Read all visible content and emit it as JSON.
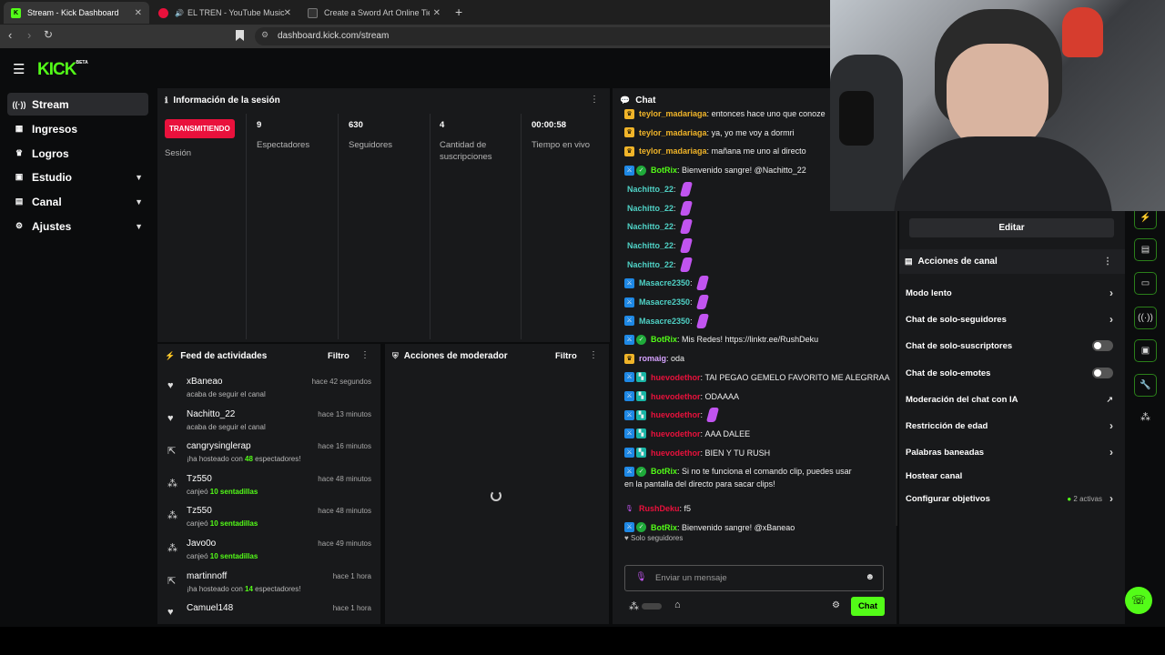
{
  "browser": {
    "tabs": [
      {
        "title": "Stream - Kick Dashboard"
      },
      {
        "title": "EL TREN - YouTube Music"
      },
      {
        "title": "Create a Sword Art Online Tier Li"
      }
    ],
    "url": "dashboard.kick.com/stream"
  },
  "brand": {
    "logo": "KICK",
    "beta": "BETA",
    "accent": "#53fc18"
  },
  "sidebar": {
    "items": [
      {
        "label": "Stream",
        "icon": "broadcast-icon"
      },
      {
        "label": "Ingresos",
        "icon": "revenue-icon"
      },
      {
        "label": "Logros",
        "icon": "trophy-icon"
      },
      {
        "label": "Estudio",
        "icon": "studio-icon"
      },
      {
        "label": "Canal",
        "icon": "channel-icon"
      },
      {
        "label": "Ajustes",
        "icon": "gear-icon"
      }
    ]
  },
  "session": {
    "title": "Información de la sesión",
    "badge": "TRANSMITIENDO",
    "badge_label": "Sesión",
    "stats": [
      {
        "value": "9",
        "label": "Espectadores"
      },
      {
        "value": "630",
        "label": "Seguidores"
      },
      {
        "value": "4",
        "label": "Cantidad de suscripciones"
      },
      {
        "value": "00:00:58",
        "label": "Tiempo en vivo"
      }
    ]
  },
  "feed": {
    "title": "Feed de actividades",
    "filter": "Filtro",
    "items": [
      {
        "name": "xBaneao",
        "time": "hace 42 segundos",
        "pre": "acaba de seguir el canal",
        "hl": "",
        "post": "",
        "icon": "heart-icon"
      },
      {
        "name": "Nachitto_22",
        "time": "hace 13 minutos",
        "pre": "acaba de seguir el canal",
        "hl": "",
        "post": "",
        "icon": "heart-icon"
      },
      {
        "name": "cangrysinglerap",
        "time": "hace 16 minutos",
        "pre": "¡ha hosteado con ",
        "hl": "48",
        "post": " espectadores!",
        "icon": "host-icon"
      },
      {
        "name": "Tz550",
        "time": "hace 48 minutos",
        "pre": "canjeó ",
        "hl": "10 sentadillas",
        "post": "",
        "icon": "points-icon"
      },
      {
        "name": "Tz550",
        "time": "hace 48 minutos",
        "pre": "canjeó ",
        "hl": "10 sentadillas",
        "post": "",
        "icon": "points-icon"
      },
      {
        "name": "Javo0o",
        "time": "hace 49 minutos",
        "pre": "canjeó ",
        "hl": "10 sentadillas",
        "post": "",
        "icon": "points-icon"
      },
      {
        "name": "martinnoff",
        "time": "hace 1 hora",
        "pre": "¡ha hosteado con ",
        "hl": "14",
        "post": " espectadores!",
        "icon": "host-icon"
      },
      {
        "name": "Camuel148",
        "time": "hace 1 hora",
        "pre": "",
        "hl": "",
        "post": "",
        "icon": "heart-icon"
      }
    ]
  },
  "moderator": {
    "title": "Acciones de moderador",
    "filter": "Filtro"
  },
  "chat": {
    "title": "Chat",
    "messages": [
      {
        "user": "teylor_madariaga",
        "color": "#f0b429",
        "text": "entonces hace uno que conoze",
        "badges": [
          "crown"
        ],
        "emote": false
      },
      {
        "user": "teylor_madariaga",
        "color": "#f0b429",
        "text": "ya, yo me voy a dormri",
        "badges": [
          "crown"
        ],
        "emote": false
      },
      {
        "user": "teylor_madariaga",
        "color": "#f0b429",
        "text": "mañana me uno al directo",
        "badges": [
          "crown"
        ],
        "emote": false
      },
      {
        "user": "BotRix",
        "color": "#53fc18",
        "text": "Bienvenido sangre! @Nachitto_22",
        "badges": [
          "mod",
          "verified"
        ],
        "emote": false
      },
      {
        "user": "Nachitto_22",
        "color": "#4fd1c5",
        "text": "",
        "badges": [],
        "emote": true
      },
      {
        "user": "Nachitto_22",
        "color": "#4fd1c5",
        "text": "",
        "badges": [],
        "emote": true
      },
      {
        "user": "Nachitto_22",
        "color": "#4fd1c5",
        "text": "",
        "badges": [],
        "emote": true
      },
      {
        "user": "Nachitto_22",
        "color": "#4fd1c5",
        "text": "",
        "badges": [],
        "emote": true
      },
      {
        "user": "Nachitto_22",
        "color": "#4fd1c5",
        "text": "",
        "badges": [],
        "emote": true
      },
      {
        "user": "Masacre2350",
        "color": "#4fd1c5",
        "text": "",
        "badges": [
          "mod"
        ],
        "emote": true
      },
      {
        "user": "Masacre2350",
        "color": "#4fd1c5",
        "text": "",
        "badges": [
          "mod"
        ],
        "emote": true
      },
      {
        "user": "Masacre2350",
        "color": "#4fd1c5",
        "text": "",
        "badges": [
          "mod"
        ],
        "emote": true
      },
      {
        "user": "BotRix",
        "color": "#53fc18",
        "text": "Mis Redes! https://linktr.ee/RushDeku",
        "badges": [
          "mod",
          "verified"
        ],
        "emote": false
      },
      {
        "user": "romaig",
        "color": "#d6a2ff",
        "text": "oda",
        "badges": [
          "crown"
        ],
        "emote": false
      },
      {
        "user": "huevodethor",
        "color": "#e9113c",
        "text": "TAI PEGAO GEMELO FAVORITO ME ALEGRRAA",
        "badges": [
          "mod",
          "sub"
        ],
        "emote": false
      },
      {
        "user": "huevodethor",
        "color": "#e9113c",
        "text": "ODAAAA",
        "badges": [
          "mod",
          "sub"
        ],
        "emote": false
      },
      {
        "user": "huevodethor",
        "color": "#e9113c",
        "text": "",
        "badges": [
          "mod",
          "sub"
        ],
        "emote": true
      },
      {
        "user": "huevodethor",
        "color": "#e9113c",
        "text": "AAA DALEE",
        "badges": [
          "mod",
          "sub"
        ],
        "emote": false
      },
      {
        "user": "huevodethor",
        "color": "#e9113c",
        "text": "BIEN Y TU RUSH",
        "badges": [
          "mod",
          "sub"
        ],
        "emote": false
      },
      {
        "user": "BotRix",
        "color": "#53fc18",
        "text": "Si no te funciona el comando clip, puedes usar",
        "badges": [
          "mod",
          "verified"
        ],
        "emote": false
      },
      {
        "user": "RushDeku",
        "color": "#e9113c",
        "text": "f5",
        "badges": [
          "mic"
        ],
        "emote": false
      },
      {
        "user": "BotRix",
        "color": "#53fc18",
        "text": "Bienvenido sangre! @xBaneao",
        "badges": [
          "mod",
          "verified"
        ],
        "emote": false
      }
    ],
    "clip_cont": "en la pantalla del directo para sacar clips!",
    "mode": "Solo seguidores",
    "placeholder": "Enviar un mensaje",
    "send": "Chat"
  },
  "channel_actions": {
    "edit": "Editar",
    "title": "Acciones de canal",
    "items": [
      {
        "label": "Modo lento",
        "kind": "arrow"
      },
      {
        "label": "Chat de solo-seguidores",
        "kind": "arrow"
      },
      {
        "label": "Chat de solo-suscriptores",
        "kind": "toggle"
      },
      {
        "label": "Chat de solo-emotes",
        "kind": "toggle"
      },
      {
        "label": "Moderación del chat con IA",
        "kind": "external"
      },
      {
        "label": "Restricción de edad",
        "kind": "arrow"
      },
      {
        "label": "Palabras baneadas",
        "kind": "arrow"
      },
      {
        "label": "Hostear canal",
        "kind": "none"
      },
      {
        "label": "Configurar objetivos",
        "kind": "goals"
      }
    ],
    "goals_active": "2 activas"
  }
}
